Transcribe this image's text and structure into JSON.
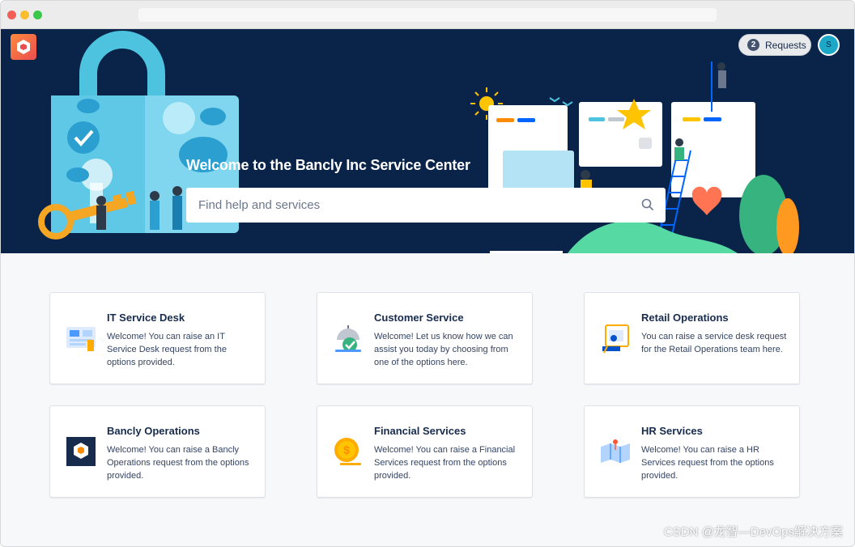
{
  "header": {
    "requests_count": "2",
    "requests_label": "Requests",
    "avatar_initial": "S"
  },
  "hero": {
    "title": "Welcome to the Bancly Inc Service Center",
    "search_placeholder": "Find help and services"
  },
  "cards": [
    {
      "title": "IT Service Desk",
      "desc": "Welcome! You can raise an IT Service Desk request from the options provided."
    },
    {
      "title": "Customer Service",
      "desc": "Welcome! Let us know how we can assist you today by choosing from one of the options here."
    },
    {
      "title": "Retail Operations",
      "desc": "You can raise a service desk request for the Retail Operations team here."
    },
    {
      "title": "Bancly Operations",
      "desc": "Welcome! You can raise a Bancly Operations request from the options provided."
    },
    {
      "title": "Financial Services",
      "desc": "Welcome! You can raise a Financial Services request from the options provided."
    },
    {
      "title": "HR Services",
      "desc": "Welcome! You can raise a HR Services request from the options provided."
    }
  ],
  "watermark": "CSDN @龙智—DevOps解决方案",
  "colors": {
    "banner": "#0a2348",
    "accent": "#0052cc",
    "text": "#172b4d"
  }
}
